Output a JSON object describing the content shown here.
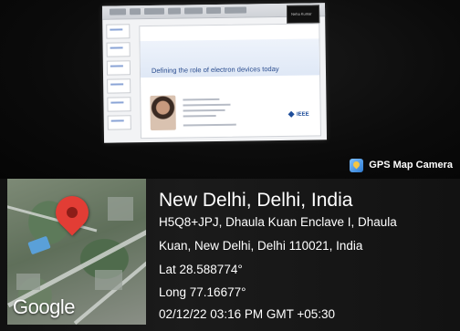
{
  "slide": {
    "presenter_label": "Neha Kumar",
    "title": "Defining the role of electron devices today",
    "logo": "IEEE"
  },
  "overlay": {
    "app_name": "GPS Map Camera",
    "app_icon": "gps-map-camera-icon",
    "place": "New Delhi, Delhi, India",
    "address_line1": "H5Q8+JPJ, Dhaula Kuan Enclave I, Dhaula",
    "address_line2": "Kuan, New Delhi, Delhi 110021, India",
    "lat": "Lat 28.588774°",
    "long": "Long 77.16677°",
    "datetime": "02/12/22 03:16 PM GMT +05:30",
    "map_logo": "Google",
    "pin_color": "#e23d35"
  }
}
